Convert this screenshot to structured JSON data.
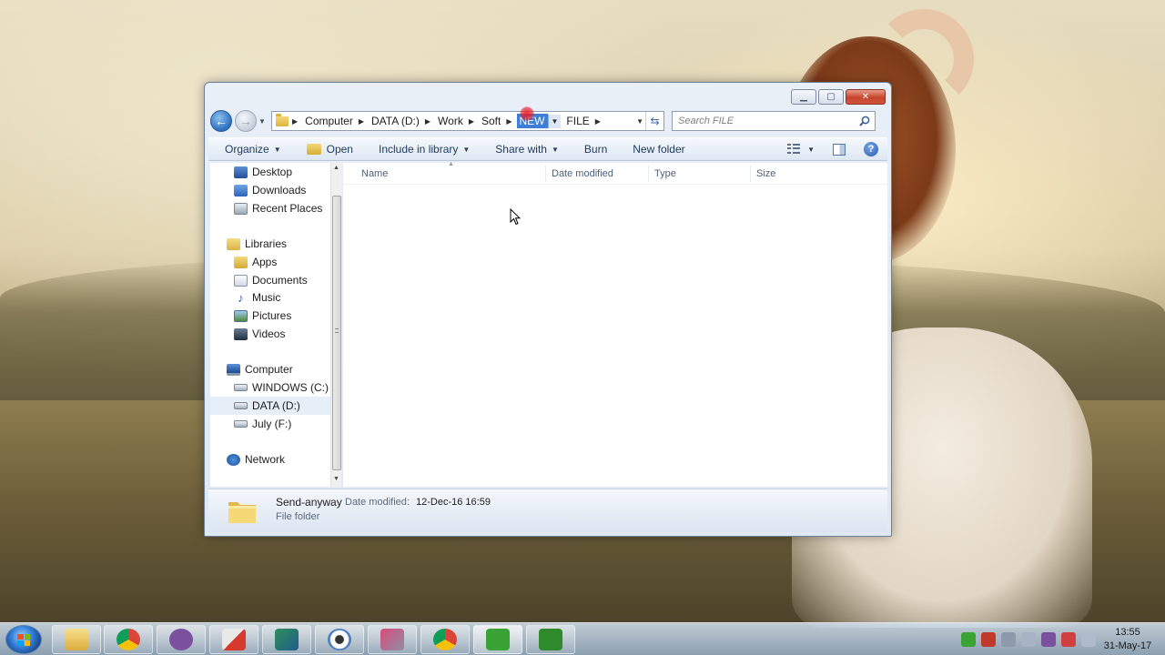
{
  "window": {
    "breadcrumbs": [
      {
        "label": "Computer"
      },
      {
        "label": "DATA (D:)"
      },
      {
        "label": "Work"
      },
      {
        "label": "Soft"
      },
      {
        "label": "NEW"
      },
      {
        "label": "FILE"
      }
    ],
    "search_placeholder": "Search FILE"
  },
  "toolbar": {
    "organize": "Organize",
    "open": "Open",
    "include_in_library": "Include in library",
    "share_with": "Share with",
    "burn": "Burn",
    "new_folder": "New folder"
  },
  "nav": {
    "favorites": [
      "Desktop",
      "Downloads",
      "Recent Places"
    ],
    "libraries": "Libraries",
    "library_items": [
      "Apps",
      "Documents",
      "Music",
      "Pictures",
      "Videos"
    ],
    "computer": "Computer",
    "drives": [
      "WINDOWS (C:)",
      "DATA (D:)",
      "July (F:)"
    ],
    "network": "Network",
    "selected": "DATA (D:)"
  },
  "columns": {
    "name": "Name",
    "date_modified": "Date modified",
    "type": "Type",
    "size": "Size"
  },
  "details": {
    "name": "Send-anyway",
    "modified_label": "Date modified:",
    "modified_value": "12-Dec-16 16:59",
    "type": "File folder"
  },
  "taskbar": {
    "apps": [
      "explorer",
      "chrome",
      "viber",
      "app-red",
      "feather-pen",
      "eye-app",
      "scissors-tool",
      "chrome-2",
      "camtasia",
      "camtasia-2"
    ],
    "time": "13:55",
    "date": "31-May-17"
  },
  "colors": {
    "accent": "#3d7fd6",
    "close_button": "#c7442d",
    "window_frame": "#dfe8f3"
  }
}
